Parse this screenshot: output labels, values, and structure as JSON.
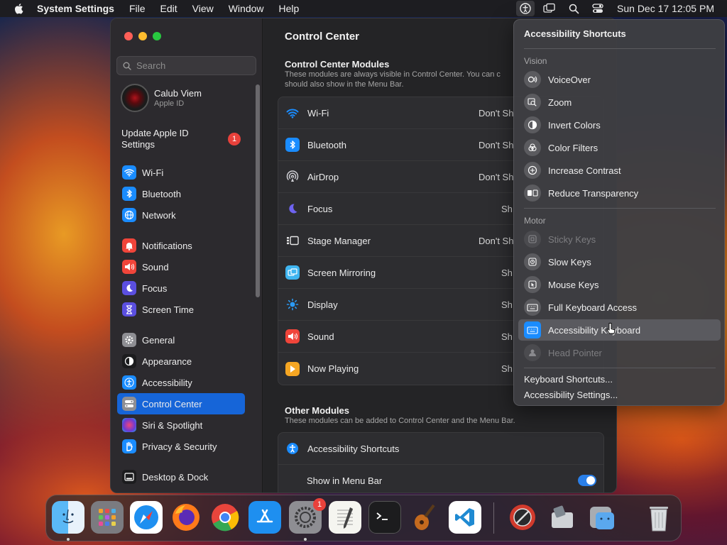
{
  "menubar": {
    "app_name": "System Settings",
    "menus": [
      "File",
      "Edit",
      "View",
      "Window",
      "Help"
    ],
    "clock": "Sun Dec 17  12:05 PM"
  },
  "window": {
    "search": {
      "placeholder": "Search"
    },
    "profile": {
      "name": "Calub Viem",
      "subtitle": "Apple ID"
    },
    "update": {
      "label": "Update Apple ID Settings",
      "badge": "1"
    },
    "sidebar": [
      {
        "label": "Wi-Fi",
        "icon": "wifi-icon",
        "color": "#1a8cff"
      },
      {
        "label": "Bluetooth",
        "icon": "bluetooth-icon",
        "color": "#1a8cff"
      },
      {
        "label": "Network",
        "icon": "globe-icon",
        "color": "#1a8cff"
      },
      {
        "label": "Notifications",
        "icon": "bell-icon",
        "color": "#f0453a"
      },
      {
        "label": "Sound",
        "icon": "speaker-icon",
        "color": "#f0453a"
      },
      {
        "label": "Focus",
        "icon": "moon-icon",
        "color": "#5b4fe0"
      },
      {
        "label": "Screen Time",
        "icon": "hourglass-icon",
        "color": "#5b4fe0"
      },
      {
        "label": "General",
        "icon": "gear-icon",
        "color": "#8e8e93"
      },
      {
        "label": "Appearance",
        "icon": "appearance-icon",
        "color": "#1c1c1e"
      },
      {
        "label": "Accessibility",
        "icon": "accessibility-icon",
        "color": "#1a8cff"
      },
      {
        "label": "Control Center",
        "icon": "control-center-icon",
        "color": "#8e8e93"
      },
      {
        "label": "Siri & Spotlight",
        "icon": "siri-icon",
        "color": "#b54bd6"
      },
      {
        "label": "Privacy & Security",
        "icon": "hand-icon",
        "color": "#1a8cff"
      },
      {
        "label": "Desktop & Dock",
        "icon": "dock-icon",
        "color": "#1c1c1e"
      }
    ],
    "selected": "Control Center",
    "content": {
      "title": "Control Center",
      "modules_title": "Control Center Modules",
      "modules_desc": "These modules are always visible in Control Center. You can c should also show in the Menu Bar.",
      "modules": [
        {
          "label": "Wi-Fi",
          "value": "Don't Sh",
          "icon": "wifi-icon",
          "color": "#1a8cff"
        },
        {
          "label": "Bluetooth",
          "value": "Don't Sh",
          "icon": "bluetooth-icon",
          "color": "#1a8cff"
        },
        {
          "label": "AirDrop",
          "value": "Don't Sh",
          "icon": "airdrop-icon",
          "color": "#e8e8ea"
        },
        {
          "label": "Focus",
          "value": "Sh",
          "icon": "moon-icon",
          "color": "#5b4fe0"
        },
        {
          "label": "Stage Manager",
          "value": "Don't Sh",
          "icon": "stage-manager-icon",
          "color": "#1c1c1e"
        },
        {
          "label": "Screen Mirroring",
          "value": "Sh",
          "icon": "screen-mirroring-icon",
          "color": "#3fb5f0"
        },
        {
          "label": "Display",
          "value": "Sh",
          "icon": "sun-icon",
          "color": "#1a8cff"
        },
        {
          "label": "Sound",
          "value": "Sh",
          "icon": "speaker-icon",
          "color": "#f0453a"
        },
        {
          "label": "Now Playing",
          "value": "Sh",
          "icon": "play-icon",
          "color": "#f5a623"
        }
      ],
      "other_title": "Other Modules",
      "other_desc": "These modules can be added to Control Center and the Menu Bar.",
      "other": [
        {
          "label": "Accessibility Shortcuts",
          "icon": "accessibility-icon",
          "color": "#1a8cff"
        },
        {
          "label": "Show in Menu Bar",
          "toggle": true
        }
      ]
    }
  },
  "popup": {
    "title": "Accessibility Shortcuts",
    "vision_label": "Vision",
    "vision": [
      {
        "label": "VoiceOver",
        "icon": "voiceover-icon"
      },
      {
        "label": "Zoom",
        "icon": "zoom-icon"
      },
      {
        "label": "Invert Colors",
        "icon": "invert-colors-icon"
      },
      {
        "label": "Color Filters",
        "icon": "color-filters-icon"
      },
      {
        "label": "Increase Contrast",
        "icon": "increase-contrast-icon"
      },
      {
        "label": "Reduce Transparency",
        "icon": "reduce-transparency-icon"
      }
    ],
    "motor_label": "Motor",
    "motor": [
      {
        "label": "Sticky Keys",
        "icon": "sticky-keys-icon",
        "disabled": true
      },
      {
        "label": "Slow Keys",
        "icon": "slow-keys-icon"
      },
      {
        "label": "Mouse Keys",
        "icon": "mouse-keys-icon"
      },
      {
        "label": "Full Keyboard Access",
        "icon": "keyboard-icon"
      },
      {
        "label": "Accessibility Keyboard",
        "icon": "accessibility-keyboard-icon",
        "highlighted": true
      },
      {
        "label": "Head Pointer",
        "icon": "head-pointer-icon",
        "disabled": true
      }
    ],
    "links": [
      "Keyboard Shortcuts...",
      "Accessibility Settings..."
    ]
  },
  "dock": {
    "apps": [
      {
        "name": "Finder",
        "icon": "finder-icon",
        "running": true
      },
      {
        "name": "Launchpad",
        "icon": "launchpad-icon"
      },
      {
        "name": "Safari",
        "icon": "safari-icon"
      },
      {
        "name": "Firefox",
        "icon": "firefox-icon"
      },
      {
        "name": "Chrome",
        "icon": "chrome-icon"
      },
      {
        "name": "App Store",
        "icon": "app-store-icon"
      },
      {
        "name": "System Settings",
        "icon": "system-settings-icon",
        "running": true,
        "badge": "1"
      },
      {
        "name": "TextEdit",
        "icon": "textedit-icon"
      },
      {
        "name": "Terminal",
        "icon": "terminal-icon"
      },
      {
        "name": "GarageBand",
        "icon": "garageband-icon"
      },
      {
        "name": "Visual Studio Code",
        "icon": "vscode-icon"
      },
      {
        "name": "Instruments",
        "icon": "instruments-icon"
      },
      {
        "name": "Disk Utility",
        "icon": "disk-utility-icon"
      },
      {
        "name": "Finder Folder",
        "icon": "finder-folder-icon"
      },
      {
        "name": "Trash",
        "icon": "trash-icon"
      }
    ]
  }
}
